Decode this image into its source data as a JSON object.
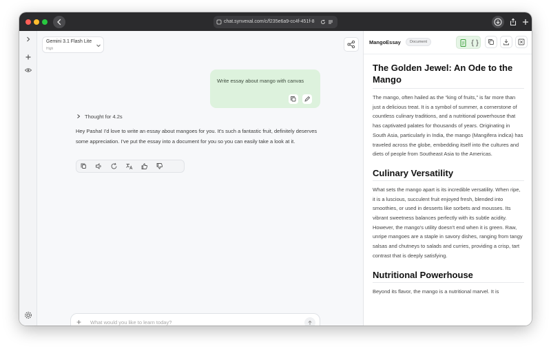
{
  "browser": {
    "url": "chat.synvexal.com/c/f235e6a9-cc4f-451f-8"
  },
  "model_selector": {
    "name": "Gemini 3.1 Flash Lite",
    "level": "High"
  },
  "conversation": {
    "user_message": "Write essay about mango with canvas",
    "thought_label": "Thought for 4.2s",
    "assistant_message": "Hey Pasha! I'd love to write an essay about mangoes for you. It's such a fantastic fruit, definitely deserves some appreciation. I've put the essay into a document for you so you can easily take a look at it."
  },
  "composer": {
    "placeholder": "What would you like to learn today?"
  },
  "document_panel": {
    "title": "MangoEssay",
    "badge": "Document",
    "heading": "The Golden Jewel: An Ode to the Mango",
    "intro": "The mango, often hailed as the “king of fruits,” is far more than just a delicious treat. It is a symbol of summer, a cornerstone of countless culinary traditions, and a nutritional powerhouse that has captivated palates for thousands of years. Originating in South Asia, particularly in India, the mango (Mangifera indica) has traveled across the globe, embedding itself into the cultures and diets of people from Southeast Asia to the Americas.",
    "section1_heading": "Culinary Versatility",
    "section1_text": "What sets the mango apart is its incredible versatility. When ripe, it is a luscious, succulent fruit enjoyed fresh, blended into smoothies, or used in desserts like sorbets and mousses. Its vibrant sweetness balances perfectly with its subtle acidity. However, the mango's utility doesn't end when it is green. Raw, unripe mangoes are a staple in savory dishes, ranging from tangy salsas and chutneys to salads and curries, providing a crisp, tart contrast that is deeply satisfying.",
    "section2_heading": "Nutritional Powerhouse",
    "section2_text": "Beyond its flavor, the mango is a nutritional marvel. It is"
  },
  "colors": {
    "user_bubble": "#ddf2dd",
    "accent_green": "#4caf50",
    "close_dot": "#ff5f57",
    "minimize_dot": "#febc2e",
    "zoom_dot": "#28c840"
  }
}
